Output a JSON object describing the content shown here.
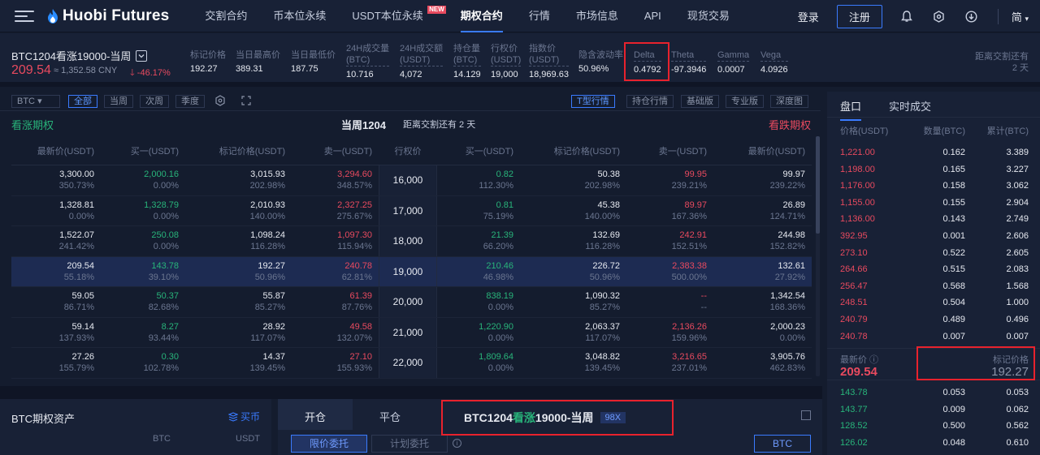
{
  "nav": {
    "brand": "Huobi Futures",
    "items": [
      {
        "label": "交割合约"
      },
      {
        "label": "币本位永续"
      },
      {
        "label": "USDT本位永续",
        "badge": "NEW"
      },
      {
        "label": "期权合约"
      },
      {
        "label": "行情"
      },
      {
        "label": "市场信息"
      },
      {
        "label": "API"
      },
      {
        "label": "现货交易"
      }
    ],
    "login": "登录",
    "register": "注册",
    "language": "简"
  },
  "ticker": {
    "contract": "BTC1204看涨19000-当周",
    "last_price": "209.54",
    "cny_price": "≈ 1,352.58 CNY",
    "change": "-46.17%",
    "stats": [
      {
        "label": "标记价格",
        "value": "192.27"
      },
      {
        "label": "当日最高价",
        "value": "389.31"
      },
      {
        "label": "当日最低价",
        "value": "187.75"
      },
      {
        "label": "24H成交量",
        "label2": "(BTC)",
        "value": "10.716"
      },
      {
        "label": "24H成交额",
        "label2": "(USDT)",
        "value": "4,072"
      },
      {
        "label": "持仓量",
        "label2": "(BTC)",
        "value": "14.129"
      },
      {
        "label": "行权价",
        "label2": "(USDT)",
        "value": "19,000"
      },
      {
        "label": "指数价",
        "label2": "(USDT)",
        "value": "18,969.63"
      },
      {
        "label": "隐含波动率",
        "value": "50.96%"
      },
      {
        "label": "Delta",
        "value": "0.4792"
      },
      {
        "label": "Theta",
        "value": "-97.3946"
      },
      {
        "label": "Gamma",
        "value": "0.0007"
      },
      {
        "label": "Vega",
        "value": "4.0926"
      }
    ],
    "settle_label": "距离交割还有",
    "settle_value": "2 天"
  },
  "toolbar": {
    "coin": "BTC",
    "filters": [
      "全部",
      "当周",
      "次周",
      "季度"
    ],
    "views": [
      "T型行情",
      "持仓行情",
      "基础版",
      "专业版",
      "深度图"
    ],
    "calls_label": "看涨期权",
    "puts_label": "看跌期权",
    "expiry_title": "当周1204",
    "expiry_countdown": "距离交割还有  2 天"
  },
  "table": {
    "headers": [
      "最新价(USDT)",
      "买一(USDT)",
      "标记价格(USDT)",
      "卖一(USDT)",
      "行权价",
      "买一(USDT)",
      "标记价格(USDT)",
      "卖一(USDT)",
      "最新价(USDT)"
    ],
    "rows": [
      {
        "strike": "16,000",
        "c_last": "3,300.00",
        "c_last_s": "350.73%",
        "c_bid": "2,000.16",
        "c_bid_s": "0.00%",
        "c_mark": "3,015.93",
        "c_mark_s": "202.98%",
        "c_ask": "3,294.60",
        "c_ask_s": "348.57%",
        "p_bid": "0.82",
        "p_bid_s": "112.30%",
        "p_mark": "50.38",
        "p_mark_s": "202.98%",
        "p_ask": "99.95",
        "p_ask_s": "239.21%",
        "p_last": "99.97",
        "p_last_s": "239.22%"
      },
      {
        "strike": "17,000",
        "c_last": "1,328.81",
        "c_last_s": "0.00%",
        "c_bid": "1,328.79",
        "c_bid_s": "0.00%",
        "c_mark": "2,010.93",
        "c_mark_s": "140.00%",
        "c_ask": "2,327.25",
        "c_ask_s": "275.67%",
        "p_bid": "0.81",
        "p_bid_s": "75.19%",
        "p_mark": "45.38",
        "p_mark_s": "140.00%",
        "p_ask": "89.97",
        "p_ask_s": "167.36%",
        "p_last": "26.89",
        "p_last_s": "124.71%"
      },
      {
        "strike": "18,000",
        "c_last": "1,522.07",
        "c_last_s": "241.42%",
        "c_bid": "250.08",
        "c_bid_s": "0.00%",
        "c_mark": "1,098.24",
        "c_mark_s": "116.28%",
        "c_ask": "1,097.30",
        "c_ask_s": "115.94%",
        "p_bid": "21.39",
        "p_bid_s": "66.20%",
        "p_mark": "132.69",
        "p_mark_s": "116.28%",
        "p_ask": "242.91",
        "p_ask_s": "152.51%",
        "p_last": "244.98",
        "p_last_s": "152.82%"
      },
      {
        "strike": "19,000",
        "c_last": "209.54",
        "c_last_s": "55.18%",
        "c_bid": "143.78",
        "c_bid_s": "39.10%",
        "c_mark": "192.27",
        "c_mark_s": "50.96%",
        "c_ask": "240.78",
        "c_ask_s": "62.81%",
        "p_bid": "210.46",
        "p_bid_s": "46.98%",
        "p_mark": "226.72",
        "p_mark_s": "50.96%",
        "p_ask": "2,383.38",
        "p_ask_s": "500.00%",
        "p_last": "132.61",
        "p_last_s": "27.92%"
      },
      {
        "strike": "20,000",
        "c_last": "59.05",
        "c_last_s": "86.71%",
        "c_bid": "50.37",
        "c_bid_s": "82.68%",
        "c_mark": "55.87",
        "c_mark_s": "85.27%",
        "c_ask": "61.39",
        "c_ask_s": "87.76%",
        "p_bid": "838.19",
        "p_bid_s": "0.00%",
        "p_mark": "1,090.32",
        "p_mark_s": "85.27%",
        "p_ask": "--",
        "p_ask_s": "--",
        "p_last": "1,342.54",
        "p_last_s": "168.36%"
      },
      {
        "strike": "21,000",
        "c_last": "59.14",
        "c_last_s": "137.93%",
        "c_bid": "8.27",
        "c_bid_s": "93.44%",
        "c_mark": "28.92",
        "c_mark_s": "117.07%",
        "c_ask": "49.58",
        "c_ask_s": "132.07%",
        "p_bid": "1,220.90",
        "p_bid_s": "0.00%",
        "p_mark": "2,063.37",
        "p_mark_s": "117.07%",
        "p_ask": "2,136.26",
        "p_ask_s": "159.96%",
        "p_last": "2,000.23",
        "p_last_s": "0.00%"
      },
      {
        "strike": "22,000",
        "c_last": "27.26",
        "c_last_s": "155.79%",
        "c_bid": "0.30",
        "c_bid_s": "102.78%",
        "c_mark": "14.37",
        "c_mark_s": "139.45%",
        "c_ask": "27.10",
        "c_ask_s": "155.93%",
        "p_bid": "1,809.64",
        "p_bid_s": "0.00%",
        "p_mark": "3,048.82",
        "p_mark_s": "139.45%",
        "p_ask": "3,216.65",
        "p_ask_s": "237.01%",
        "p_last": "3,905.76",
        "p_last_s": "462.83%"
      }
    ]
  },
  "assets": {
    "title": "BTC期权资产",
    "transfer": "买币",
    "col1": "BTC",
    "col2": "USDT"
  },
  "order": {
    "tab_open": "开仓",
    "tab_close": "平仓",
    "contract_prefix": "BTC1204",
    "contract_type": "看涨",
    "contract_suffix": "19000-当周",
    "leverage": "98X",
    "limit_order": "限价委托",
    "plan_order": "计划委托",
    "currency": "BTC"
  },
  "orderbook": {
    "tabs": [
      "盘口",
      "实时成交"
    ],
    "headers": [
      "价格(USDT)",
      "数量(BTC)",
      "累计(BTC)"
    ],
    "asks": [
      {
        "p": "1,221.00",
        "q": "0.162",
        "c": "3.389"
      },
      {
        "p": "1,198.00",
        "q": "0.165",
        "c": "3.227"
      },
      {
        "p": "1,176.00",
        "q": "0.158",
        "c": "3.062"
      },
      {
        "p": "1,155.00",
        "q": "0.155",
        "c": "2.904"
      },
      {
        "p": "1,136.00",
        "q": "0.143",
        "c": "2.749"
      },
      {
        "p": "392.95",
        "q": "0.001",
        "c": "2.606"
      },
      {
        "p": "273.10",
        "q": "0.522",
        "c": "2.605"
      },
      {
        "p": "264.66",
        "q": "0.515",
        "c": "2.083"
      },
      {
        "p": "256.47",
        "q": "0.568",
        "c": "1.568"
      },
      {
        "p": "248.51",
        "q": "0.504",
        "c": "1.000"
      },
      {
        "p": "240.79",
        "q": "0.489",
        "c": "0.496"
      },
      {
        "p": "240.78",
        "q": "0.007",
        "c": "0.007"
      }
    ],
    "mid_last_label": "最新价",
    "mid_last_value": "209.54",
    "mid_mark_label": "标记价格",
    "mid_mark_value": "192.27",
    "bids": [
      {
        "p": "143.78",
        "q": "0.053",
        "c": "0.053"
      },
      {
        "p": "143.77",
        "q": "0.009",
        "c": "0.062"
      },
      {
        "p": "128.52",
        "q": "0.500",
        "c": "0.562"
      },
      {
        "p": "126.02",
        "q": "0.048",
        "c": "0.610"
      }
    ]
  },
  "colors": {
    "up": "#28b47a",
    "down": "#e84a5f",
    "accent": "#3a7bff",
    "highlight": "#e8222d"
  }
}
